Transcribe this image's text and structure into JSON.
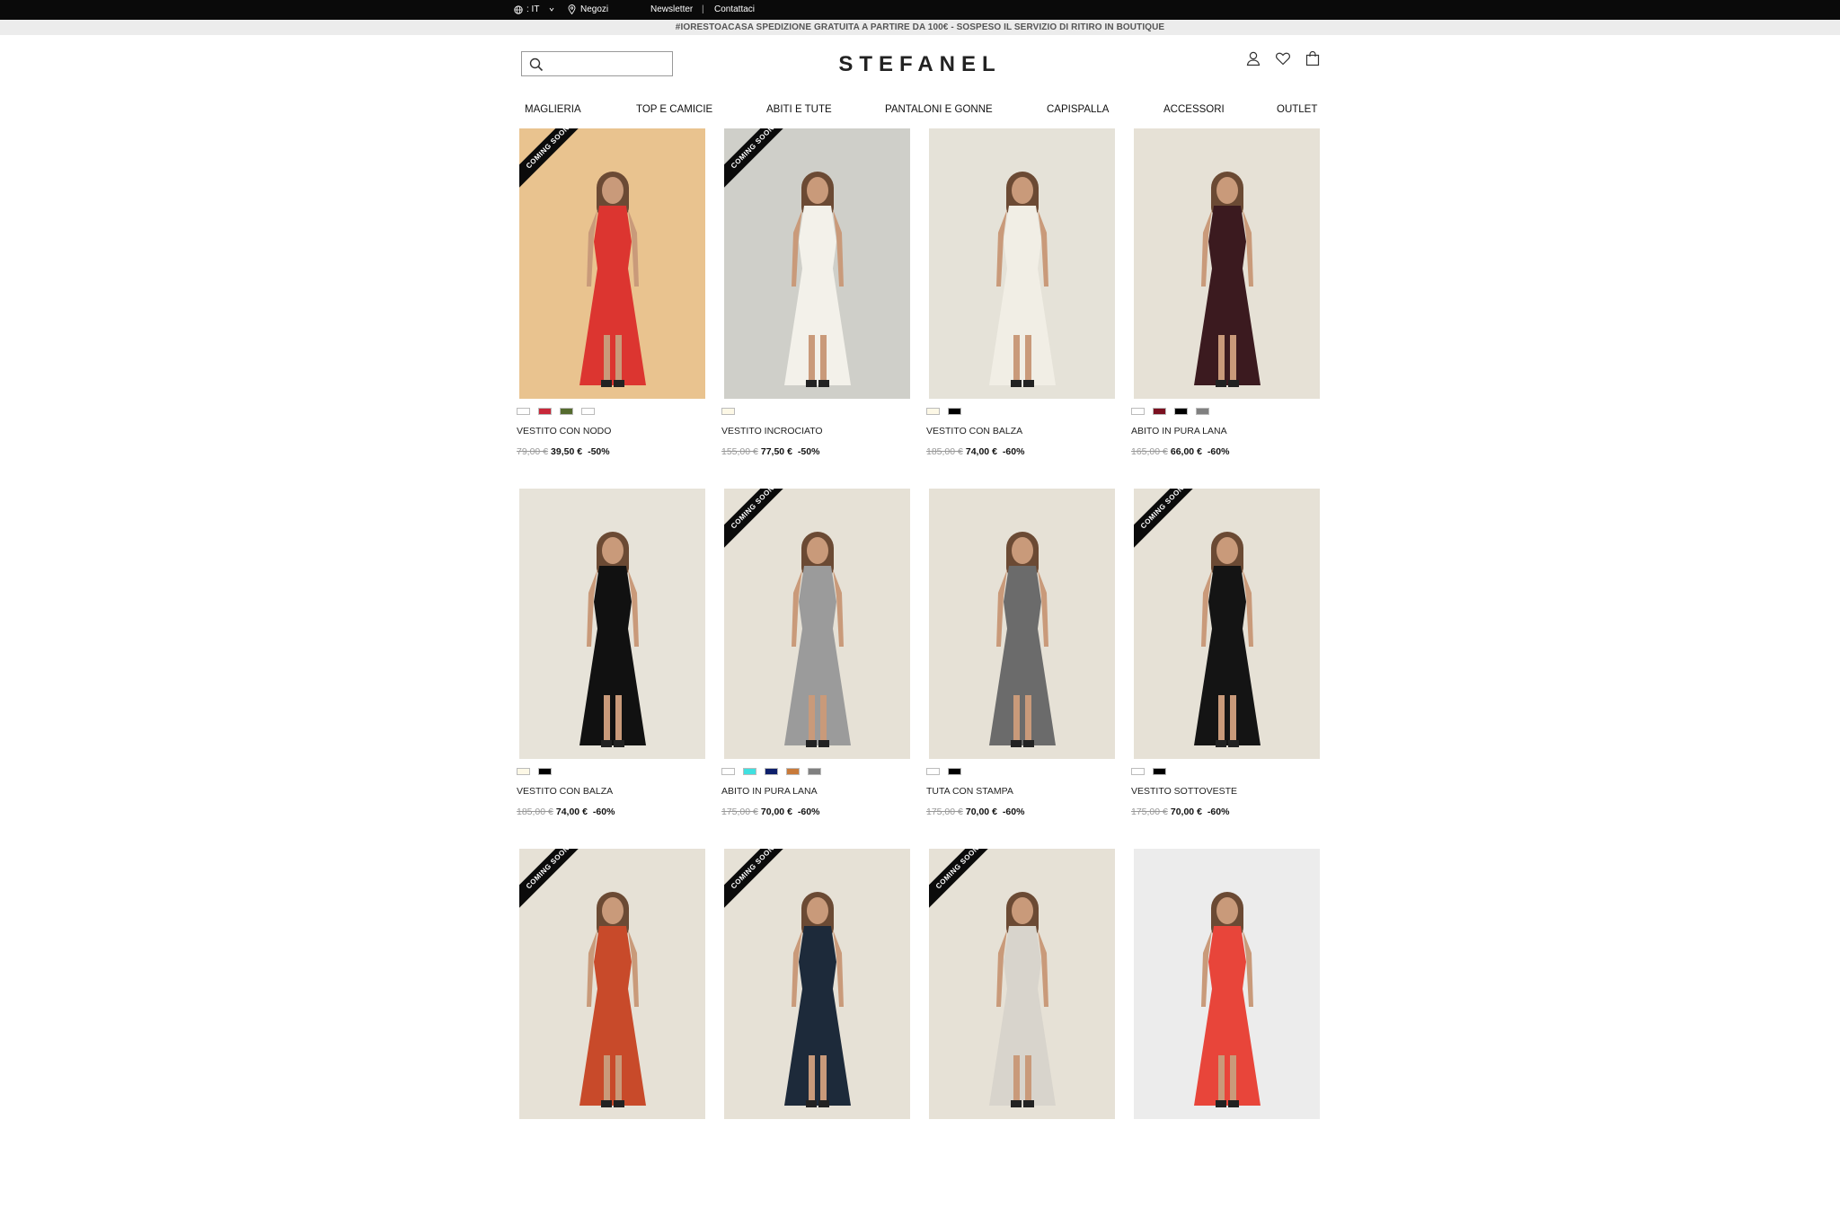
{
  "topbar": {
    "language": ": IT",
    "stores": "Negozi",
    "newsletter": "Newsletter",
    "separator": "|",
    "contact": "Contattaci"
  },
  "promo": "#IORESTOACASA SPEDIZIONE GRATUITA A PARTIRE DA 100€ - SOSPESO IL SERVIZIO DI RITIRO IN BOUTIQUE",
  "header": {
    "logo": "STEFANEL",
    "search_placeholder": ""
  },
  "nav": [
    "MAGLIERIA",
    "TOP E CAMICIE",
    "ABITI E TUTE",
    "PANTALONI E GONNE",
    "CAPISPALLA",
    "ACCESSORI",
    "OUTLET"
  ],
  "ribbon_text": "COMING SOON",
  "products": [
    {
      "name": "VESTITO CON NODO",
      "old": "79,00 €",
      "new": "39,50 €",
      "discount": "-50%",
      "coming_soon": true,
      "swatches": [
        "#ffffff",
        "#c8283a",
        "#556b2f",
        "#ffffff"
      ],
      "bg": "#e9c38f",
      "dress": "#dc3530"
    },
    {
      "name": "VESTITO INCROCIATO",
      "old": "155,00 €",
      "new": "77,50 €",
      "discount": "-50%",
      "coming_soon": true,
      "swatches": [
        "#fdf8e6"
      ],
      "bg": "#cfcfc9",
      "dress": "#f3f1ea"
    },
    {
      "name": "VESTITO CON BALZA",
      "old": "185,00 €",
      "new": "74,00 €",
      "discount": "-60%",
      "coming_soon": false,
      "swatches": [
        "#fdf8e6",
        "#000000"
      ],
      "bg": "#e5e2d8",
      "dress": "#f1eee5"
    },
    {
      "name": "ABITO IN PURA LANA",
      "old": "165,00 €",
      "new": "66,00 €",
      "discount": "-60%",
      "coming_soon": false,
      "swatches": [
        "#ffffff",
        "#7a1020",
        "#000000",
        "#808080"
      ],
      "bg": "#e6e1d6",
      "dress": "#3b1a1f"
    },
    {
      "name": "VESTITO CON BALZA",
      "old": "185,00 €",
      "new": "74,00 €",
      "discount": "-60%",
      "coming_soon": false,
      "swatches": [
        "#fdf8e6",
        "#000000"
      ],
      "bg": "#e7e3d9",
      "dress": "#111111"
    },
    {
      "name": "ABITO IN PURA LANA",
      "old": "175,00 €",
      "new": "70,00 €",
      "discount": "-60%",
      "coming_soon": true,
      "swatches": [
        "#ffffff",
        "#40e0e0",
        "#0d1f6b",
        "#c87a3a",
        "#808080"
      ],
      "bg": "#e6e1d6",
      "dress": "#9b9b9b"
    },
    {
      "name": "TUTA CON STAMPA",
      "old": "175,00 €",
      "new": "70,00 €",
      "discount": "-60%",
      "coming_soon": false,
      "swatches": [
        "#ffffff",
        "#000000"
      ],
      "bg": "#e6e1d6",
      "dress": "#6b6b6b"
    },
    {
      "name": "VESTITO SOTTOVESTE",
      "old": "175,00 €",
      "new": "70,00 €",
      "discount": "-60%",
      "coming_soon": true,
      "swatches": [
        "#ffffff",
        "#000000"
      ],
      "bg": "#e6e1d6",
      "dress": "#141414"
    },
    {
      "name": "",
      "old": "",
      "new": "",
      "discount": "",
      "coming_soon": true,
      "swatches": [],
      "bg": "#e6e1d6",
      "dress": "#c84a2a"
    },
    {
      "name": "",
      "old": "",
      "new": "",
      "discount": "",
      "coming_soon": true,
      "swatches": [],
      "bg": "#e6e1d6",
      "dress": "#1d2a3a"
    },
    {
      "name": "",
      "old": "",
      "new": "",
      "discount": "",
      "coming_soon": true,
      "swatches": [],
      "bg": "#e6e1d6",
      "dress": "#d8d4cc"
    },
    {
      "name": "",
      "old": "",
      "new": "",
      "discount": "",
      "coming_soon": false,
      "swatches": [],
      "bg": "#ececec",
      "dress": "#e8453a"
    }
  ],
  "colors": {
    "topbar_bg": "#0a0a0a",
    "promo_bg": "#ececec",
    "accent": "#111111"
  }
}
